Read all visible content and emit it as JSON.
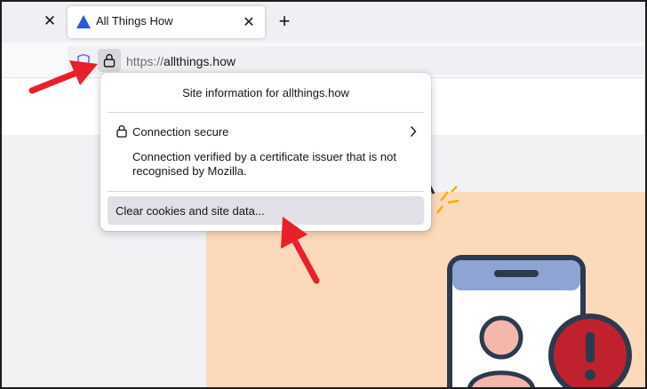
{
  "tabs": {
    "active_title": "All Things How"
  },
  "urlbar": {
    "scheme": "https://",
    "host": "allthings.how"
  },
  "popup": {
    "title": "Site information for allthings.how",
    "connection_label": "Connection secure",
    "connection_detail": "Connection verified by a certificate issuer that is not recognised by Mozilla.",
    "clear_button_label": "Clear cookies and site data..."
  },
  "colors": {
    "annotation_arrow": "#e8202a",
    "page_peach": "#fdd9bc",
    "favicon_blue": "#2a5bd7"
  },
  "icons": {
    "tab_close": "close-icon",
    "new_tab": "plus-icon",
    "tracking": "shield-icon",
    "site_info": "lock-icon",
    "chevron": "chevron-right-icon"
  }
}
